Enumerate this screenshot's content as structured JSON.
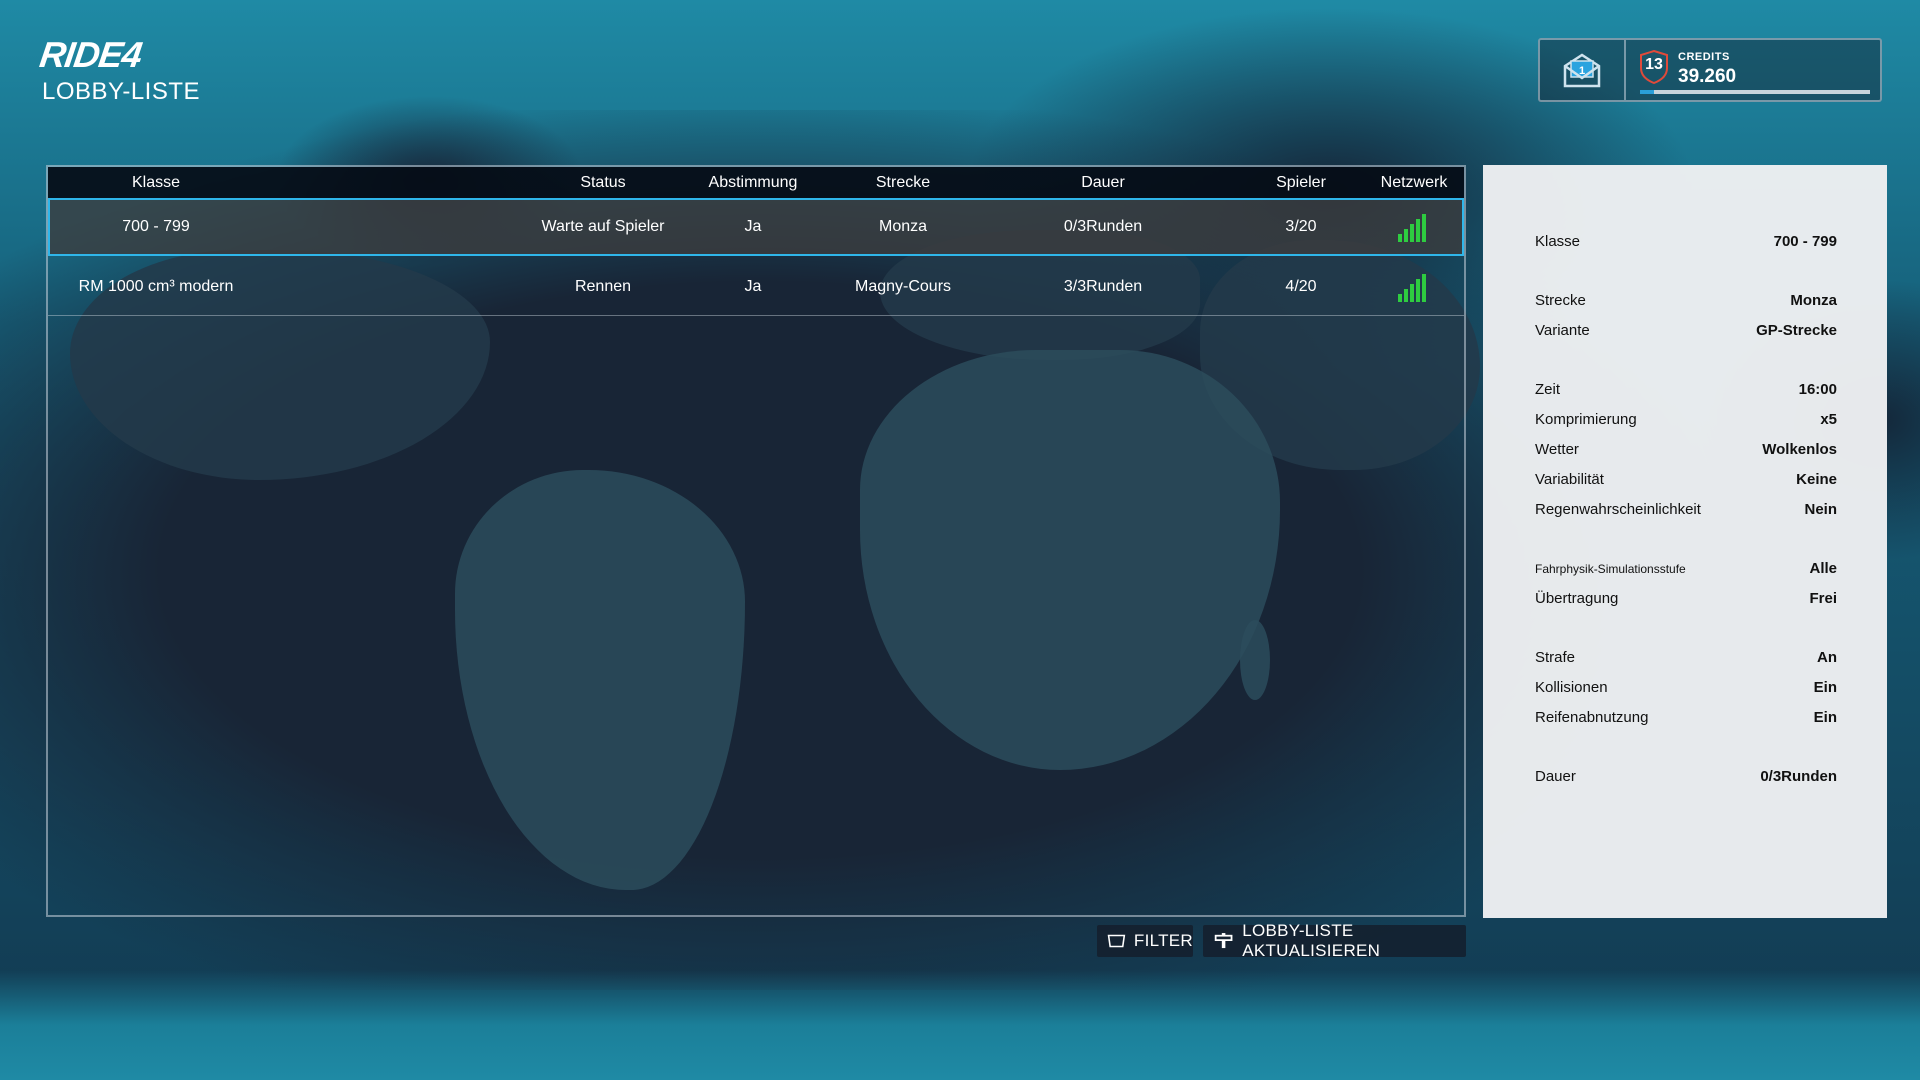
{
  "header": {
    "logo": "RIDE4",
    "page_title": "LOBBY-LISTE"
  },
  "credits": {
    "mail_count": "1",
    "level": "13",
    "label": "CREDITS",
    "value": "39.260",
    "xp_progress": 0.06
  },
  "table": {
    "columns": [
      "Klasse",
      "Status",
      "Abstimmung",
      "Strecke",
      "Dauer",
      "Spieler",
      "Netzwerk"
    ],
    "rows": [
      {
        "klasse": "700 - 799",
        "status": "Warte auf Spieler",
        "abstimmung": "Ja",
        "strecke": "Monza",
        "dauer": "0/3Runden",
        "spieler": "3/20",
        "netzwerk_bars": 5,
        "selected": true
      },
      {
        "klasse": "RM 1000 cm³ modern",
        "status": "Rennen",
        "abstimmung": "Ja",
        "strecke": "Magny-Cours",
        "dauer": "3/3Runden",
        "spieler": "4/20",
        "netzwerk_bars": 5,
        "selected": false
      }
    ]
  },
  "buttons": {
    "filter": "FILTER",
    "refresh": "LOBBY-LISTE AKTUALISIEREN"
  },
  "details": {
    "klasse_label": "Klasse",
    "klasse_value": "700 - 799",
    "strecke_label": "Strecke",
    "strecke_value": "Monza",
    "variante_label": "Variante",
    "variante_value": "GP-Strecke",
    "zeit_label": "Zeit",
    "zeit_value": "16:00",
    "kompr_label": "Komprimierung",
    "kompr_value": "x5",
    "wetter_label": "Wetter",
    "wetter_value": "Wolkenlos",
    "variab_label": "Variabilität",
    "variab_value": "Keine",
    "regen_label": "Regenwahrscheinlichkeit",
    "regen_value": "Nein",
    "physik_label": "Fahrphysik-Simulationsstufe",
    "physik_value": "Alle",
    "uebertr_label": "Übertragung",
    "uebertr_value": "Frei",
    "strafe_label": "Strafe",
    "strafe_value": "An",
    "koll_label": "Kollisionen",
    "koll_value": "Ein",
    "reifen_label": "Reifenabnutzung",
    "reifen_value": "Ein",
    "dauer_label": "Dauer",
    "dauer_value": "0/3Runden"
  },
  "colors": {
    "selection_outline": "#2fb6ea",
    "signal_green": "#2ecc40",
    "xp_blue": "#2a9fd8"
  }
}
